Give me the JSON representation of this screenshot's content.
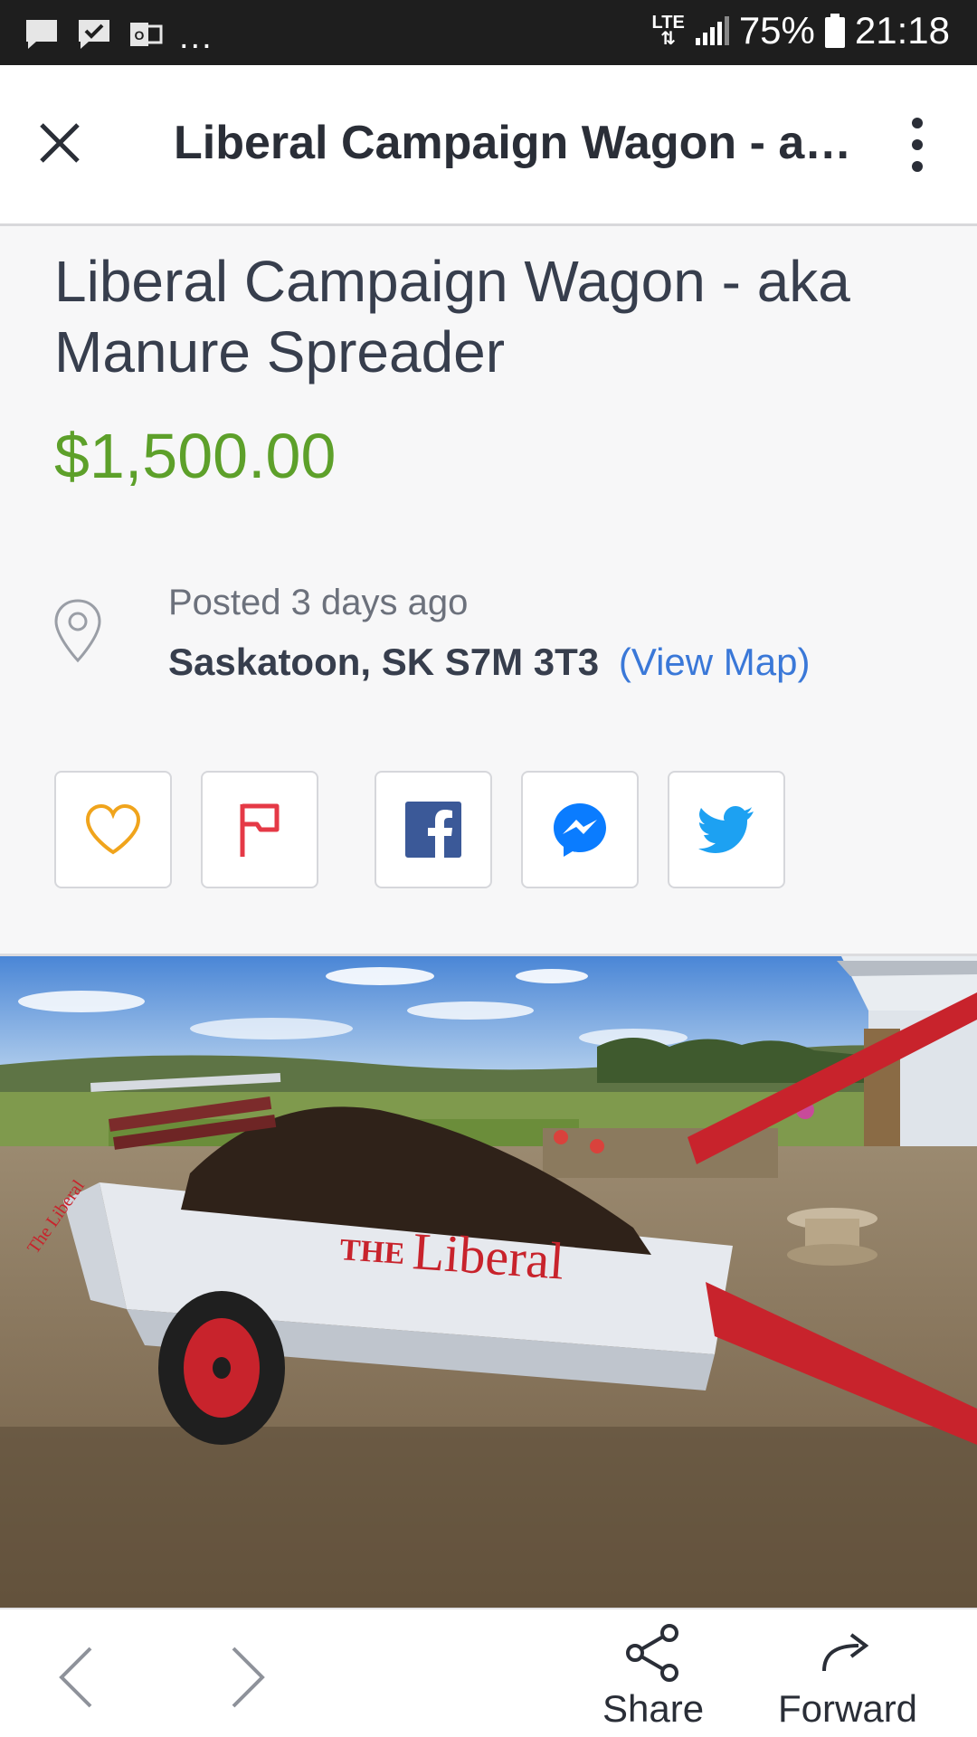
{
  "status_bar": {
    "overflow": "...",
    "network": "LTE",
    "battery": "75%",
    "time": "21:18"
  },
  "app_bar": {
    "title": "Liberal Campaign Wagon - aka Manure Spreader",
    "close_icon": "close-icon",
    "more_icon": "more-vert-icon"
  },
  "listing": {
    "title": "Liberal Campaign Wagon - aka Manure Spreader",
    "price": "$1,500.00",
    "posted": "Posted 3 days ago",
    "location": "Saskatoon, SK S7M 3T3",
    "view_map": "(View Map)"
  },
  "actions": [
    {
      "name": "favorite",
      "icon": "heart-icon",
      "color": "#f0a41c"
    },
    {
      "name": "report",
      "icon": "flag-icon",
      "color": "#e53946"
    },
    {
      "name": "facebook",
      "icon": "facebook-icon",
      "color": "#3b5998"
    },
    {
      "name": "messenger",
      "icon": "messenger-icon",
      "color": "#0a7cff"
    },
    {
      "name": "twitter",
      "icon": "twitter-icon",
      "color": "#1da1f2"
    }
  ],
  "photo": {
    "wagon_text_1": "THE",
    "wagon_text_2": "Liberal",
    "side_text": "The Liberal"
  },
  "bottom_bar": {
    "share_label": "Share",
    "forward_label": "Forward"
  },
  "colors": {
    "price": "#5da02a",
    "link": "#3a78d8",
    "text": "#373e4d"
  }
}
